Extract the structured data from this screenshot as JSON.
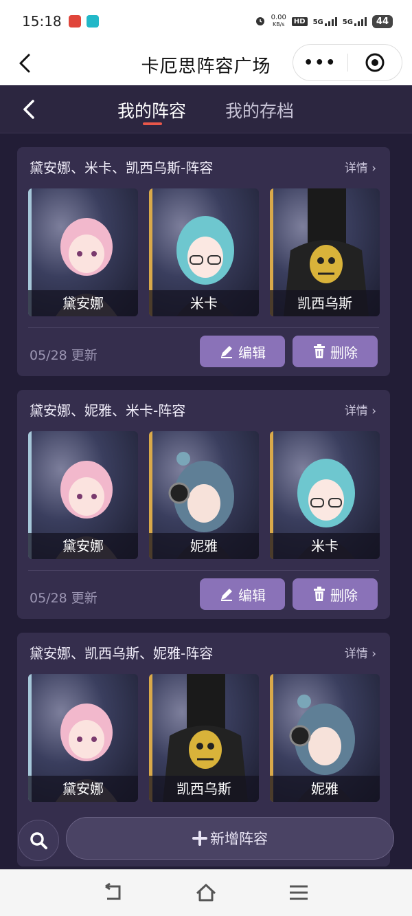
{
  "status": {
    "time": "15:18",
    "net_speed": "0.00",
    "net_unit": "KB/s",
    "hd": "HD",
    "sim1": "5G",
    "sim2": "5G",
    "battery": "44"
  },
  "miniprogram": {
    "title": "卡厄思阵容广场",
    "more_glyph": "•••"
  },
  "tabs": [
    {
      "label": "我的阵容",
      "active": true
    },
    {
      "label": "我的存档",
      "active": false
    }
  ],
  "cards": [
    {
      "title": "黛安娜、米卡、凯西乌斯-阵容",
      "detail": "详情 ›",
      "characters": [
        {
          "name": "黛安娜",
          "edge": "#a6c7d9"
        },
        {
          "name": "米卡",
          "edge": "#d9a94a"
        },
        {
          "name": "凯西乌斯",
          "edge": "#d9a94a"
        }
      ],
      "date": "05/28 更新",
      "edit_label": "编辑",
      "delete_label": "删除"
    },
    {
      "title": "黛安娜、妮雅、米卡-阵容",
      "detail": "详情 ›",
      "characters": [
        {
          "name": "黛安娜",
          "edge": "#a6c7d9"
        },
        {
          "name": "妮雅",
          "edge": "#d9a94a"
        },
        {
          "name": "米卡",
          "edge": "#d9a94a"
        }
      ],
      "date": "05/28 更新",
      "edit_label": "编辑",
      "delete_label": "删除"
    },
    {
      "title": "黛安娜、凯西乌斯、妮雅-阵容",
      "detail": "详情 ›",
      "characters": [
        {
          "name": "黛安娜",
          "edge": "#a6c7d9"
        },
        {
          "name": "凯西乌斯",
          "edge": "#d9a94a"
        },
        {
          "name": "妮雅",
          "edge": "#d9a94a"
        }
      ]
    }
  ],
  "bottom": {
    "add_label": "新增阵容"
  },
  "colors": {
    "app_bg": "#221d36",
    "card_bg": "#352e4d",
    "button": "#8a72b8",
    "tab_indicator": "#e8574a"
  }
}
